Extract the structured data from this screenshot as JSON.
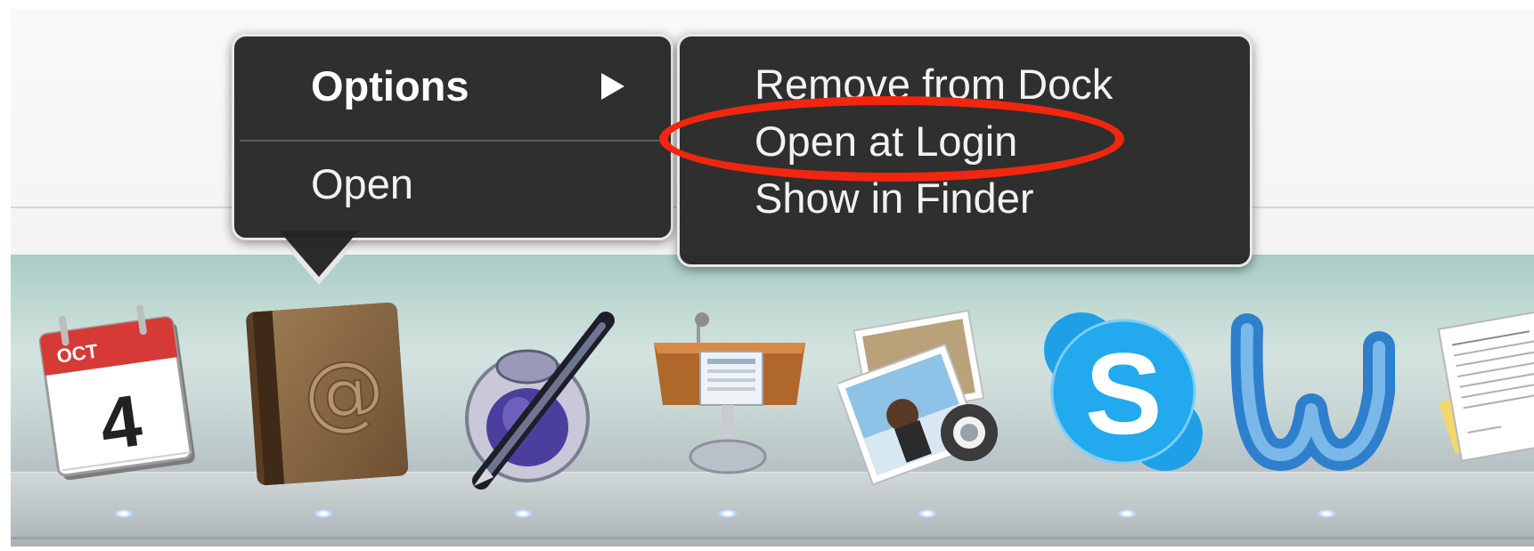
{
  "main_menu": {
    "options_label": "Options",
    "open_label": "Open"
  },
  "sub_menu": {
    "items": [
      {
        "label": "Remove from Dock"
      },
      {
        "label": "Open at Login"
      },
      {
        "label": "Show in Finder"
      }
    ]
  },
  "dock": {
    "calendar": {
      "month": "OCT",
      "day": "4"
    },
    "apps": [
      "calendar-icon",
      "address-book-icon",
      "script-editor-icon",
      "keynote-icon",
      "iphoto-icon",
      "skype-icon",
      "word-icon",
      "textedit-icon"
    ]
  },
  "colors": {
    "menu_background": "#242424",
    "highlight": "#2c61e8",
    "annotation": "#f2260f"
  }
}
